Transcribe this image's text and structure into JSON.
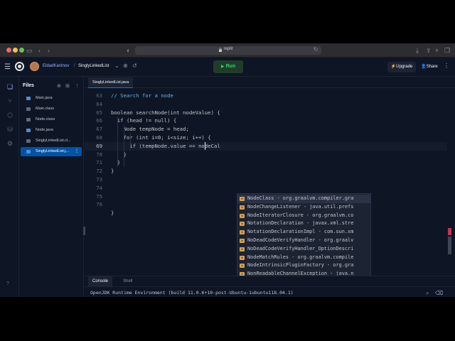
{
  "browser": {
    "url": "replit",
    "back_icon": "chevron-left-icon",
    "forward_icon": "chevron-right-icon"
  },
  "header": {
    "user": "EldadKarimov",
    "separator": "/",
    "project": "SinglyLinkedList",
    "run_label": "Run",
    "upgrade_label": "Upgrade",
    "share_label": "Share"
  },
  "files": {
    "title": "Files",
    "items": [
      {
        "name": "Main.java",
        "color": "#4a90d9"
      },
      {
        "name": "Main.class",
        "color": "#5f6b7a"
      },
      {
        "name": "Node.class",
        "color": "#5f6b7a"
      },
      {
        "name": "Node.java",
        "color": "#4a90d9"
      },
      {
        "name": "SinglyLinkedList.cl...",
        "color": "#5f6b7a"
      },
      {
        "name": "SinglyLinkedList.j...",
        "color": "#4a90d9",
        "active": true
      }
    ]
  },
  "editor": {
    "tab": "SinglyLinkedList.java",
    "lines": [
      {
        "n": "63",
        "code": "// Search for a node"
      },
      {
        "n": "64",
        "code": ""
      },
      {
        "n": "65",
        "code": "boolean searchNode(int nodeValue) {"
      },
      {
        "n": "66",
        "code": "  if (head != null) {"
      },
      {
        "n": "67",
        "code": "    Node tempNode = head;"
      },
      {
        "n": "68",
        "code": "    for (int i=0; i<size; i++) {"
      },
      {
        "n": "69",
        "code": "      if (tempNode.value == nodeCal"
      },
      {
        "n": "70",
        "code": "    }"
      },
      {
        "n": "71",
        "code": "  }"
      },
      {
        "n": "72",
        "code": "}"
      },
      {
        "n": "73",
        "code": ""
      },
      {
        "n": "74",
        "code": ""
      },
      {
        "n": "75",
        "code": ""
      },
      {
        "n": "76",
        "code": ""
      },
      {
        "n": "",
        "code": "}"
      }
    ]
  },
  "autocomplete": [
    {
      "text": "NodeClass - org.graalvm.compiler.gra"
    },
    {
      "text": "NodeChangeListener - java.util.prefs"
    },
    {
      "text": "NodeIteratorClosure - org.graalvm.co"
    },
    {
      "text": "NotationDeclaration - javax.xml.stre"
    },
    {
      "text": "NotationDeclarationImpl - com.sun.xm"
    },
    {
      "text": "NoDeadCodeVerifyHandler - org.graalv"
    },
    {
      "text": "NoDeadCodeVerifyHandler_OptionDescri"
    },
    {
      "text": "NodeMatchRules - org.graalvm.compile"
    },
    {
      "text": "NodeIntrinsicPluginFactory - org.gra"
    },
    {
      "text": "NonReadableChannelException - java.n"
    }
  ],
  "console": {
    "tabs": [
      "Console",
      "Shell"
    ],
    "output": "OpenJDK Runtime Environment (build 11.0.6+10-post-Ubuntu-1ubuntu118.04.1)",
    "prompt": ">"
  },
  "help_label": "?"
}
